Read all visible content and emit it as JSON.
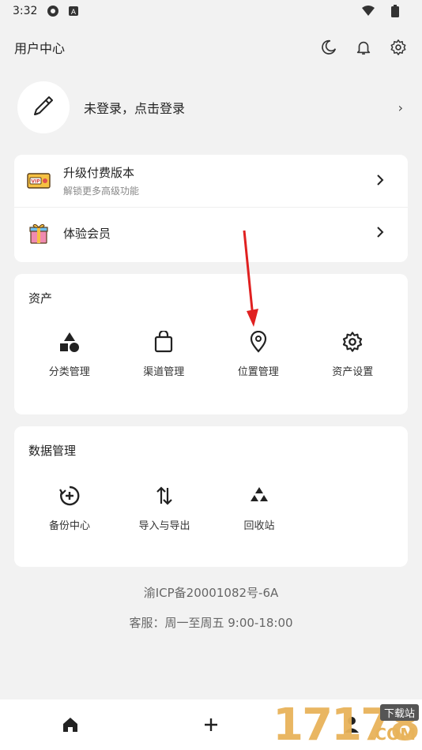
{
  "status_bar": {
    "time": "3:32"
  },
  "header": {
    "title": "用户中心"
  },
  "profile": {
    "login_text": "未登录，点击登录",
    "chevron": "›"
  },
  "promo": [
    {
      "label": "升级付费版本",
      "sublabel": "解锁更多高级功能",
      "icon": "vip-ticket-icon"
    },
    {
      "label": "体验会员",
      "sublabel": "",
      "icon": "gift-box-icon"
    }
  ],
  "assets": {
    "title": "资产",
    "items": [
      {
        "label": "分类管理",
        "icon": "category-shapes-icon"
      },
      {
        "label": "渠道管理",
        "icon": "shopping-bag-icon"
      },
      {
        "label": "位置管理",
        "icon": "location-pin-icon"
      },
      {
        "label": "资产设置",
        "icon": "gear-icon"
      }
    ]
  },
  "data_management": {
    "title": "数据管理",
    "items": [
      {
        "label": "备份中心",
        "icon": "backup-icon"
      },
      {
        "label": "导入与导出",
        "icon": "import-export-icon"
      },
      {
        "label": "回收站",
        "icon": "recycle-icon"
      }
    ]
  },
  "footer": {
    "icp": "渝ICP备20001082号-6A",
    "service": "客服：周一至周五 9:00-18:00"
  },
  "watermark": {
    "number": "17178",
    "tag": "下载站",
    "domain": ".COM"
  },
  "colors": {
    "accent": "#1f1f1f",
    "arrow": "#e02020"
  }
}
